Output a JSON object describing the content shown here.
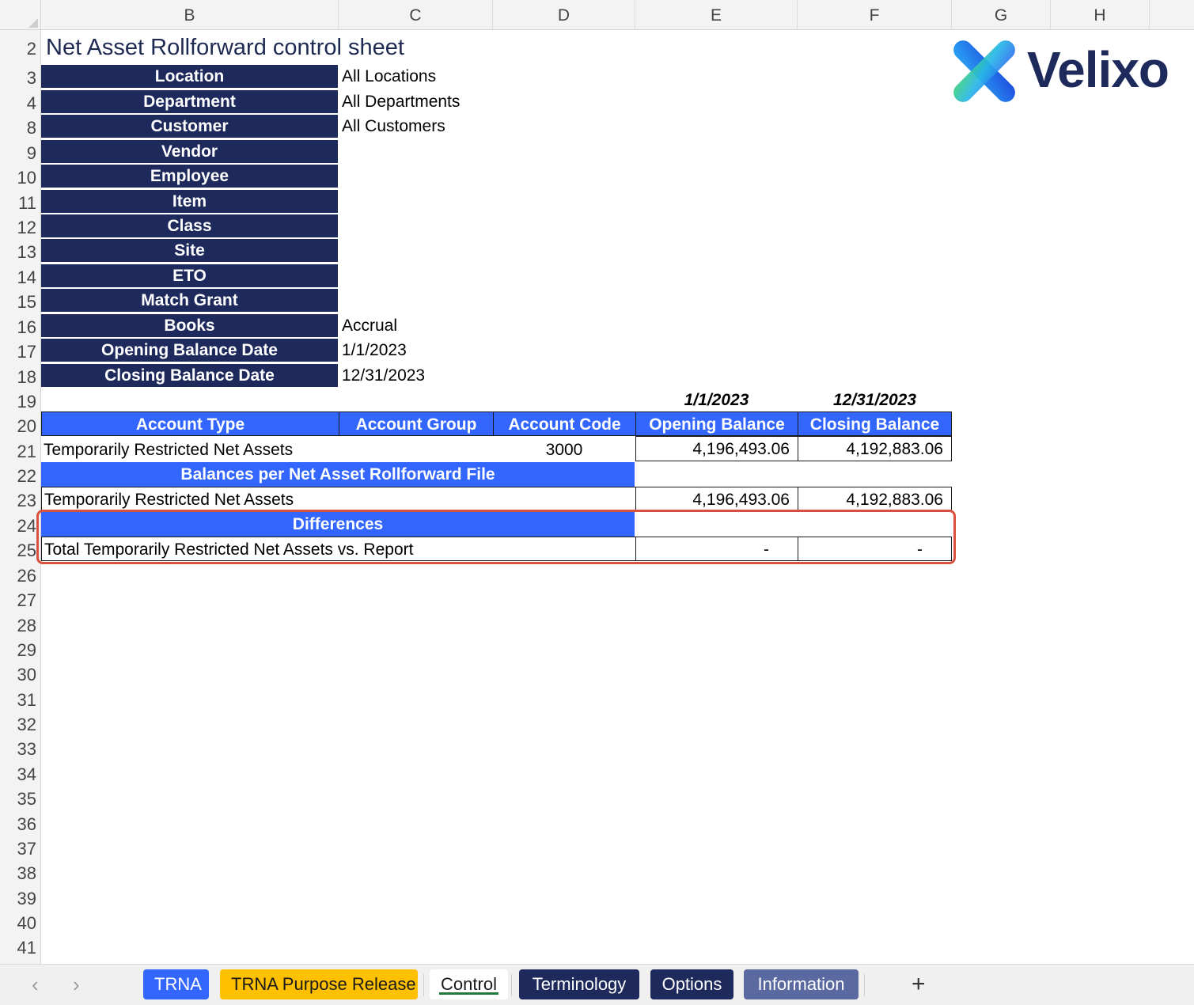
{
  "columns": [
    "B",
    "C",
    "D",
    "E",
    "F",
    "G",
    "H"
  ],
  "rows": [
    "2",
    "3",
    "4",
    "8",
    "9",
    "10",
    "11",
    "12",
    "13",
    "14",
    "15",
    "16",
    "17",
    "18",
    "19",
    "20",
    "21",
    "22",
    "23",
    "24",
    "25",
    "26",
    "27",
    "28",
    "29",
    "30",
    "31",
    "32",
    "33",
    "34",
    "35",
    "36",
    "37",
    "38",
    "39",
    "40",
    "41"
  ],
  "title": "Net Asset Rollforward control sheet",
  "logo": {
    "text": "Velixo",
    "colors": [
      "#2aa4f4",
      "#1f4fe0",
      "#3fd17a",
      "#1f2a5c"
    ]
  },
  "filters": [
    {
      "label": "Location",
      "value": "All Locations"
    },
    {
      "label": "Department",
      "value": "All Departments"
    },
    {
      "label": "Customer",
      "value": "All Customers"
    },
    {
      "label": "Vendor",
      "value": ""
    },
    {
      "label": "Employee",
      "value": ""
    },
    {
      "label": "Item",
      "value": ""
    },
    {
      "label": "Class",
      "value": ""
    },
    {
      "label": "Site",
      "value": ""
    },
    {
      "label": "ETO",
      "value": ""
    },
    {
      "label": "Match Grant",
      "value": ""
    },
    {
      "label": "Books",
      "value": "Accrual"
    },
    {
      "label": "Opening Balance Date",
      "value": "1/1/2023"
    },
    {
      "label": "Closing Balance Date",
      "value": "12/31/2023"
    }
  ],
  "dates": {
    "opening": "1/1/2023",
    "closing": "12/31/2023"
  },
  "table": {
    "headers": [
      "Account Type",
      "Account Group",
      "Account Code",
      "Opening Balance",
      "Closing Balance"
    ],
    "row1": {
      "type": "Temporarily Restricted Net Assets",
      "group": "",
      "code": "3000",
      "opening": "4,196,493.06",
      "closing": "4,192,883.06"
    }
  },
  "section_balances": {
    "title": "Balances per Net Asset Rollforward File",
    "row": {
      "label": "Temporarily Restricted Net Assets",
      "opening": "4,196,493.06",
      "closing": "4,192,883.06"
    }
  },
  "section_differences": {
    "title": "Differences",
    "row": {
      "label": "Total Temporarily Restricted Net Assets vs. Report",
      "opening": "-",
      "closing": "-"
    }
  },
  "highlight_color": "#d9503f",
  "header_colors": {
    "navy": "#1f2a5c",
    "blue": "#3366ff"
  },
  "sheet_tabs": [
    {
      "label": "TRNA",
      "bg": "#3366ff",
      "fg": "#ffffff",
      "active": false
    },
    {
      "label": "TRNA Purpose Release",
      "bg": "#ffc000",
      "fg": "#1a1a1a",
      "active": false
    },
    {
      "label": "Control",
      "bg": "#ffffff",
      "fg": "#1a1a1a",
      "active": true
    },
    {
      "label": "Terminology",
      "bg": "#1f2a5c",
      "fg": "#ffffff",
      "active": false
    },
    {
      "label": "Options",
      "bg": "#1f2a5c",
      "fg": "#ffffff",
      "active": false
    },
    {
      "label": "Information",
      "bg": "#5a6aa0",
      "fg": "#ffffff",
      "active": false
    }
  ],
  "tab_nav": {
    "prev": "‹",
    "next": "›",
    "add": "+"
  }
}
